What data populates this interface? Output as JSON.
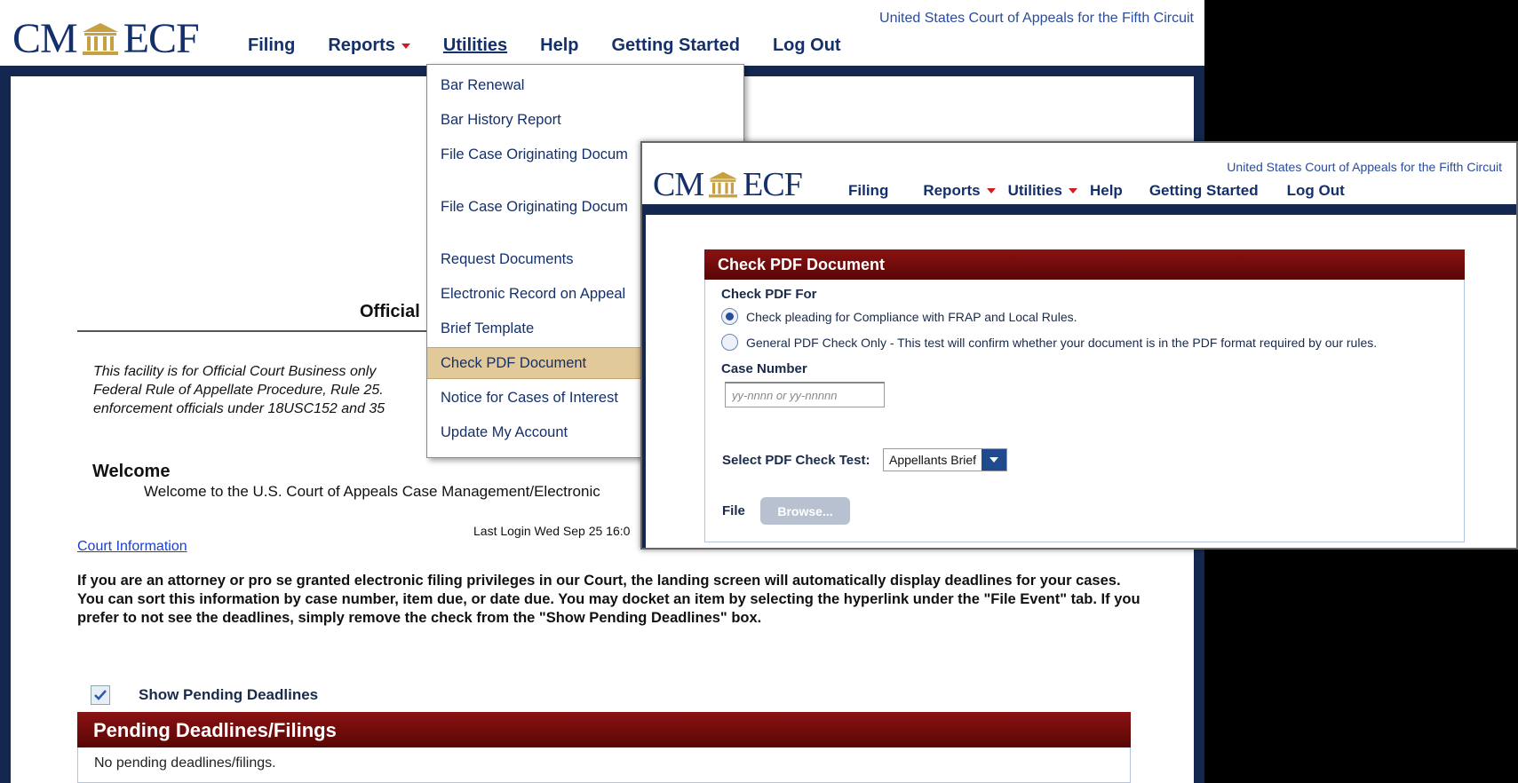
{
  "app": {
    "logo_left": "CM",
    "logo_right": "ECF",
    "court_name": "United States Court of Appeals for the Fifth Circuit"
  },
  "nav": {
    "filing": "Filing",
    "reports": "Reports",
    "utilities": "Utilities",
    "help": "Help",
    "getting_started": "Getting Started",
    "log_out": "Log Out"
  },
  "utilities_menu": {
    "items": [
      "Bar Renewal",
      "Bar History Report",
      "File Case Originating Docum",
      "File Case Originating Docum",
      "Request Documents",
      "Electronic Record on Appeal",
      "Brief Template",
      "Check PDF Document",
      "Notice for Cases of Interest",
      "Update My Account"
    ],
    "selected_index": 7
  },
  "main": {
    "official_title": "Official",
    "notice_lines": [
      "This facility is for Official Court Business only",
      "Federal Rule of Appellate Procedure, Rule 25.",
      "enforcement officials under 18USC152 and 35"
    ],
    "welcome_heading": "Welcome",
    "welcome_text": "Welcome to the U.S. Court of Appeals Case Management/Electronic",
    "last_login": "Last Login Wed Sep 25 16:0",
    "court_info_link": "Court Information",
    "deadlines_paragraph": "If you are an attorney or pro se granted electronic filing privileges in our Court, the landing screen will automatically display deadlines for your cases. You can sort this information by case number, item due, or date due. You may docket an item by selecting the hyperlink under the \"File Event\" tab. If you prefer to not see the deadlines, simply remove the check from the \"Show Pending Deadlines\" box.",
    "show_pending_label": "Show Pending Deadlines",
    "show_pending_checked": true,
    "pending_title": "Pending Deadlines/Filings",
    "pending_empty": "No pending deadlines/filings."
  },
  "check_pdf": {
    "panel_title": "Check PDF Document",
    "check_for_label": "Check PDF For",
    "option_1": "Check pleading for Compliance with FRAP and Local Rules.",
    "option_2": "General PDF Check Only - This test will confirm whether your document is in the PDF format required by our rules.",
    "selected_option": 1,
    "case_number_label": "Case Number",
    "case_number_placeholder": "yy-nnnn or yy-nnnnn",
    "case_number_value": "",
    "select_test_label": "Select PDF Check Test:",
    "select_test_value": "Appellants Brief",
    "file_label": "File",
    "browse_label": "Browse..."
  },
  "colors": {
    "navy": "#14306b",
    "frame": "#14284f",
    "header_red": "#7a0e0e",
    "menu_highlight": "#e2c99a",
    "link": "#1a3fcf"
  }
}
